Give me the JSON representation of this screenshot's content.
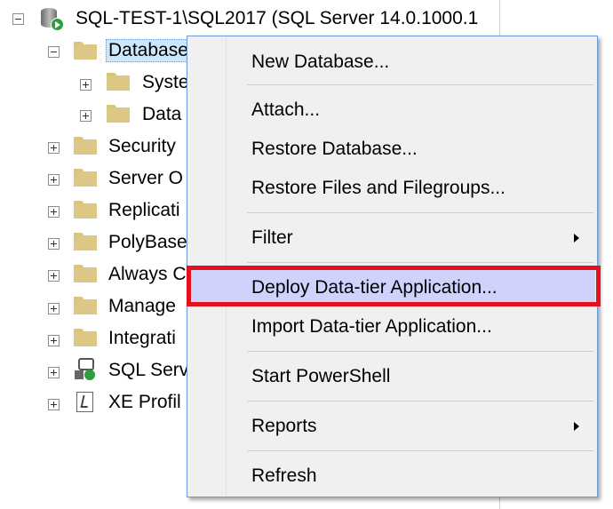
{
  "tree": {
    "server_label": "SQL-TEST-1\\SQL2017 (SQL Server 14.0.1000.1",
    "databases_label": "Database",
    "children_of_databases": [
      {
        "label": "Syste"
      },
      {
        "label": "Data"
      }
    ],
    "nodes": [
      {
        "label": "Security"
      },
      {
        "label": "Server O"
      },
      {
        "label": "Replicati"
      },
      {
        "label": "PolyBase"
      },
      {
        "label": "Always C"
      },
      {
        "label": "Manage"
      },
      {
        "label": "Integrati"
      },
      {
        "label": "SQL Serv",
        "icon": "sql-agent-icon"
      },
      {
        "label": "XE Profil",
        "icon": "xe-profiler-icon"
      }
    ]
  },
  "context_menu": {
    "items": [
      {
        "label": "New Database..."
      },
      {
        "label": "Attach..."
      },
      {
        "label": "Restore Database..."
      },
      {
        "label": "Restore Files and Filegroups..."
      },
      {
        "label": "Filter",
        "submenu": true
      },
      {
        "label": "Deploy Data-tier Application...",
        "highlighted": true
      },
      {
        "label": "Import Data-tier Application..."
      },
      {
        "label": "Start PowerShell"
      },
      {
        "label": "Reports",
        "submenu": true
      },
      {
        "label": "Refresh"
      }
    ]
  },
  "colors": {
    "menu_background": "#f0f0f0",
    "menu_border": "#6b9bd8",
    "highlight_background": "#cfd3fb",
    "highlight_frame": "#e3101e",
    "folder": "#dcc785"
  }
}
